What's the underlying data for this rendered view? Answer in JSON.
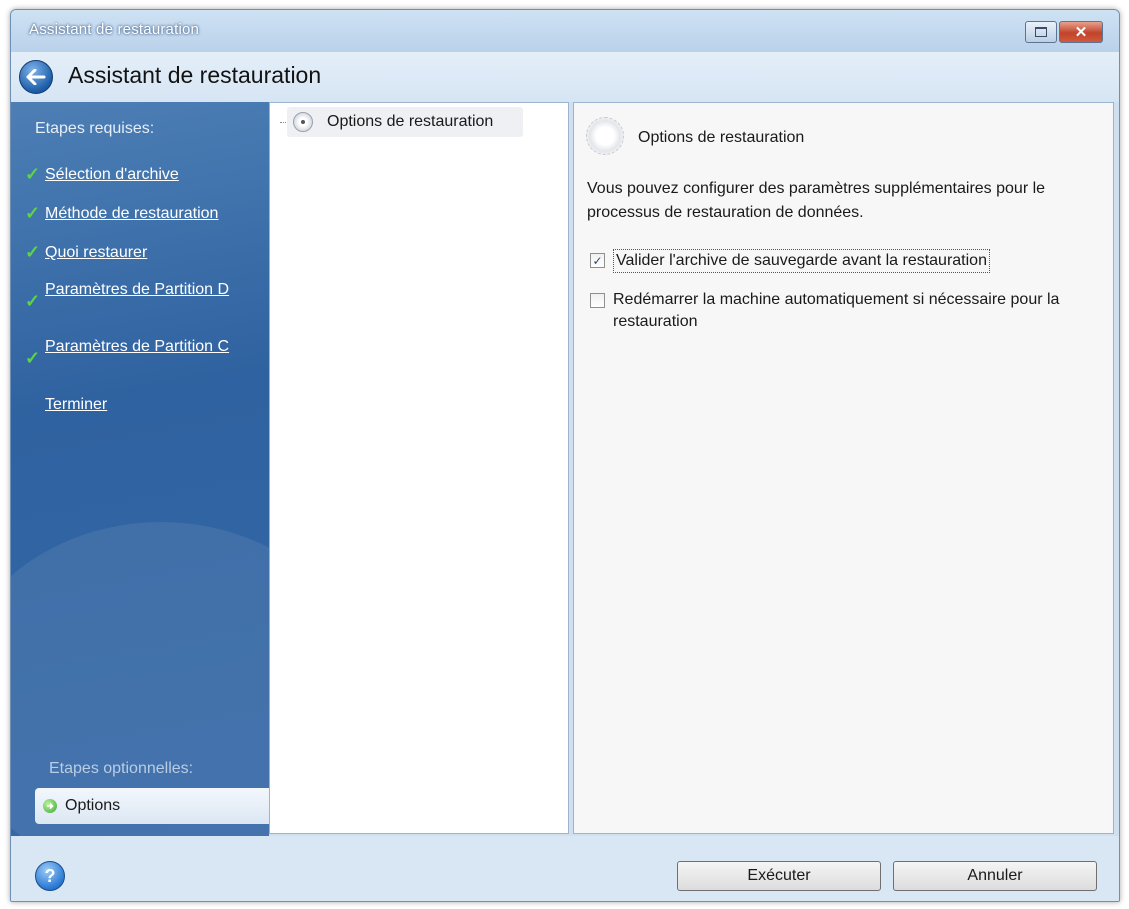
{
  "window": {
    "title": "Assistant de restauration",
    "header_title": "Assistant de restauration"
  },
  "sidebar": {
    "required_heading": "Etapes requises:",
    "steps": [
      {
        "label": "Sélection d'archive",
        "done": true
      },
      {
        "label": "Méthode de restauration",
        "done": true
      },
      {
        "label": "Quoi restaurer",
        "done": true
      },
      {
        "label": "Paramètres de Partition D",
        "done": true
      },
      {
        "label": "Paramètres de Partition C",
        "done": true
      },
      {
        "label": "Terminer",
        "done": false
      }
    ],
    "optional_heading": "Etapes optionnelles:",
    "optional_item": "Options"
  },
  "tree": {
    "node_label": "Options de restauration"
  },
  "detail": {
    "title": "Options de restauration",
    "description": "Vous pouvez configurer des paramètres supplémentaires pour le processus de restauration de données.",
    "options": [
      {
        "label": "Valider l'archive de sauvegarde avant la restauration",
        "checked": true
      },
      {
        "label": "Redémarrer la machine automatiquement si nécessaire pour la restauration",
        "checked": false
      }
    ]
  },
  "buttons": {
    "execute": "Exécuter",
    "cancel": "Annuler"
  },
  "icons": {
    "back": "back-arrow-icon",
    "help": "help-icon",
    "check": "check-icon",
    "gear": "gear-icon"
  },
  "colors": {
    "sidebar": "#3568a6",
    "check": "#5bd447",
    "accent": "#1d5ea8"
  }
}
